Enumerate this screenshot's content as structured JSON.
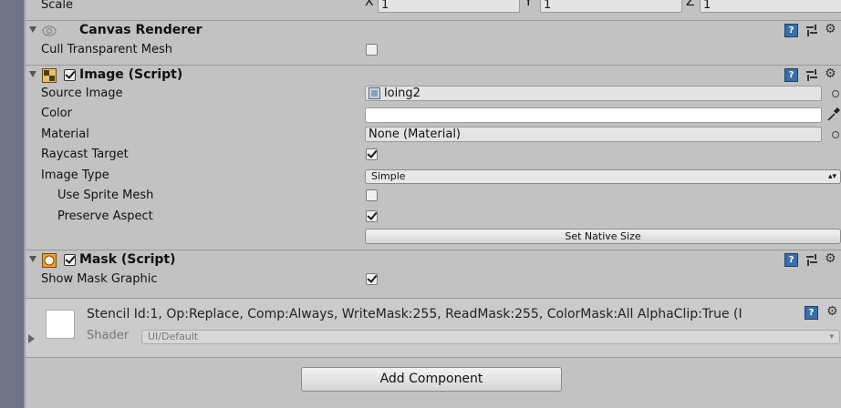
{
  "transform": {
    "scale_label": "Scale",
    "axes": [
      {
        "axis": "X",
        "value": "1"
      },
      {
        "axis": "Y",
        "value": "1"
      },
      {
        "axis": "Z",
        "value": "1"
      }
    ]
  },
  "canvas_renderer": {
    "title": "Canvas Renderer",
    "cull_label": "Cull Transparent Mesh",
    "cull_checked": false
  },
  "image_script": {
    "title": "Image (Script)",
    "source_image_label": "Source Image",
    "source_image_value": "loing2",
    "color_label": "Color",
    "color_value": "#ffffff",
    "material_label": "Material",
    "material_value": "None (Material)",
    "raycast_label": "Raycast Target",
    "raycast_checked": true,
    "image_type_label": "Image Type",
    "image_type_value": "Simple",
    "use_sprite_mesh_label": "Use Sprite Mesh",
    "use_sprite_mesh_checked": false,
    "preserve_aspect_label": "Preserve Aspect",
    "preserve_aspect_checked": true,
    "set_native_size_label": "Set Native Size"
  },
  "mask_script": {
    "title": "Mask (Script)",
    "show_mask_label": "Show Mask Graphic",
    "show_mask_checked": true
  },
  "material_preview": {
    "stencil_text": "Stencil Id:1, Op:Replace, Comp:Always, WriteMask:255, ReadMask:255, ColorMask:All AlphaClip:True (I",
    "shader_label": "Shader",
    "shader_value": "UI/Default"
  },
  "add_component_label": "Add Component",
  "colors": {
    "panel_bg": "#c2c2c2",
    "help_icon": "#3b6ea8",
    "left_bar": "#6e7385"
  }
}
